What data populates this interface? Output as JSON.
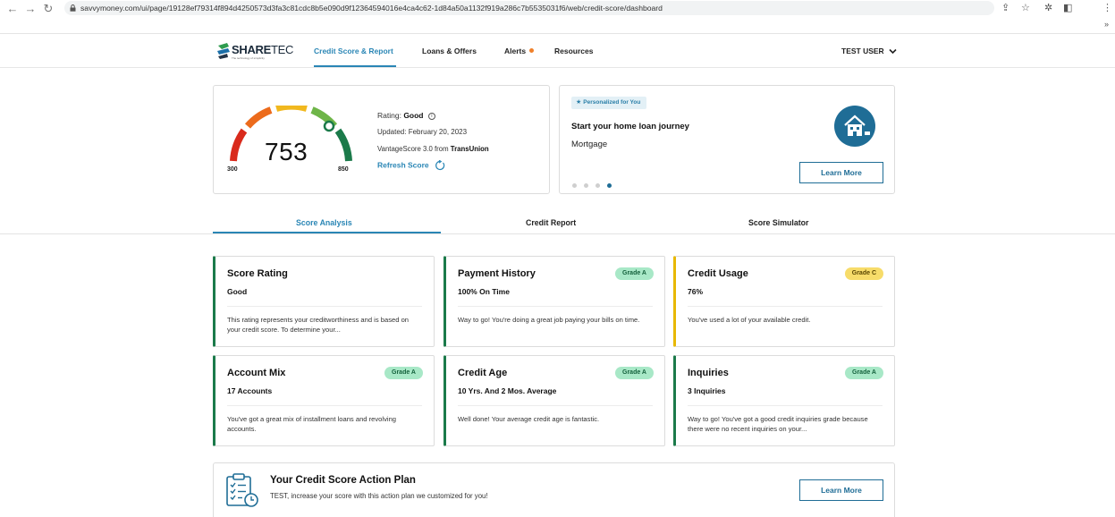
{
  "browser": {
    "url": "savvymoney.com/ui/page/19128ef79314f894d4250573d3fa3c81cdc8b5e090d9f12364594016e4ca4c62-1d84a50a1132f919a286c7b5535031f6/web/credit-score/dashboard"
  },
  "header": {
    "logo_main": "SHARE",
    "logo_accent": "TEC",
    "logo_tagline": "The technology of simplicity",
    "nav": [
      {
        "label": "Credit Score & Report"
      },
      {
        "label": "Loans & Offers"
      },
      {
        "label": "Alerts"
      },
      {
        "label": "Resources"
      }
    ],
    "user": "TEST USER"
  },
  "score": {
    "value": "753",
    "min": "300",
    "max": "850",
    "rating_label": "Rating:",
    "rating_value": "Good",
    "updated": "Updated: February 20, 2023",
    "model_prefix": "VantageScore 3.0 from ",
    "bureau": "TransUnion",
    "refresh_label": "Refresh Score"
  },
  "promo": {
    "badge": "Personalized for You",
    "title": "Start your home loan journey",
    "subtitle": "Mortgage",
    "button": "Learn More",
    "dots_total": 4,
    "dots_active": 4
  },
  "tabs": [
    {
      "label": "Score Analysis"
    },
    {
      "label": "Credit Report"
    },
    {
      "label": "Score Simulator"
    }
  ],
  "factors": [
    {
      "title": "Score Rating",
      "value": "Good",
      "grade": "",
      "desc": "This rating represents your creditworthiness and is based on your credit score. To determine your..."
    },
    {
      "title": "Payment History",
      "value": "100% On Time",
      "grade": "Grade A",
      "desc": "Way to go! You're doing a great job paying your bills on time."
    },
    {
      "title": "Credit Usage",
      "value": "76%",
      "grade": "Grade C",
      "desc": "You've used a lot of your available credit."
    },
    {
      "title": "Account Mix",
      "value": "17 Accounts",
      "grade": "Grade A",
      "desc": "You've got a great mix of installment loans and revolving accounts."
    },
    {
      "title": "Credit Age",
      "value": "10 Yrs. And 2 Mos. Average",
      "grade": "Grade A",
      "desc": "Well done! Your average credit age is fantastic."
    },
    {
      "title": "Inquiries",
      "value": "3 Inquiries",
      "grade": "Grade A",
      "desc": "Way to go! You've got a good credit inquiries grade because there were no recent inquiries on your..."
    }
  ],
  "action_plan": {
    "title": "Your Credit Score Action Plan",
    "subtitle": "TEST, increase your score with this action plan we customized for you!",
    "button": "Learn More"
  },
  "colors": {
    "accent": "#2a86b5",
    "dark_accent": "#1f6d96",
    "good_border": "#1b7a4a",
    "warn_border": "#e8b800",
    "grade_a_bg": "#a8e8c7",
    "grade_c_bg": "#f7dc6a"
  }
}
